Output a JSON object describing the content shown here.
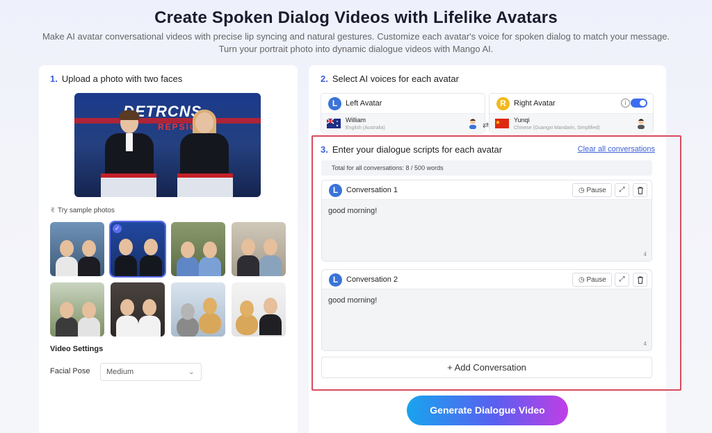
{
  "header": {
    "title": "Create Spoken Dialog Videos with Lifelike Avatars",
    "subtitle_line1": "Make AI avatar conversational videos with precise lip syncing and natural gestures. Customize each avatar's voice for spoken dialog to match your message.",
    "subtitle_line2": "Turn your portrait photo into dynamic dialogue videos with Mango AI."
  },
  "upload": {
    "step_num": "1.",
    "step_label": "Upload a photo with two faces",
    "banner_text": "DETRCNS",
    "banner_sub": "REPSION",
    "sample_label": "✌ Try sample photos"
  },
  "video_settings": {
    "title": "Video Settings",
    "facial_pose_label": "Facial Pose",
    "facial_pose_value": "Medium"
  },
  "voices": {
    "step_num": "2.",
    "step_label": "Select AI voices for each avatar",
    "left": {
      "letter": "L",
      "title": "Left Avatar",
      "voice": "William",
      "lang": "English (Australia)",
      "color": "#3a73d9"
    },
    "right": {
      "letter": "R",
      "title": "Right Avatar",
      "voice": "Yunqi",
      "lang": "Chinese (Guangxi Mandarin, Simplified)",
      "color": "#f2b81c"
    },
    "swap_icon": "⇄",
    "info_icon": "i"
  },
  "scripts": {
    "step_num": "3.",
    "step_label": "Enter your dialogue scripts for each avatar",
    "clear_label": "Clear all conversations",
    "total_label": "Total for all conversations: 8 / 500 words",
    "conversations": [
      {
        "letter": "L",
        "title": "Conversation 1",
        "pause": "Pause",
        "text": "good morning!",
        "count": "4"
      },
      {
        "letter": "L",
        "title": "Conversation 2",
        "pause": "Pause",
        "text": "good morning!",
        "count": "4"
      }
    ],
    "add_label": "+ Add Conversation",
    "generate_label": "Generate Dialogue Video"
  },
  "colors": {
    "accent": "#3a5ed8",
    "highlight": "#d94a5e"
  }
}
